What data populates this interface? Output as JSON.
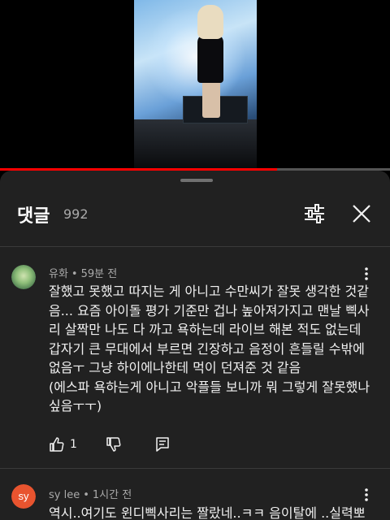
{
  "video": {
    "progress_fraction": 0.71,
    "progress_color": "#ff0000"
  },
  "comments_panel": {
    "title": "댓글",
    "count": "992",
    "icons": {
      "filter": "sliders-icon",
      "close": "close-icon"
    }
  },
  "comments": [
    {
      "author": "유화",
      "time": "59분 전",
      "text": "잘했고 못했고 따지는 게 아니고 수만씨가 잘못 생각한 것같음... 요즘 아이돌 평가 기준만 겁나 높아져가지고 맨날 삑사리 살짝만 나도 다 까고 욕하는데 라이브 해본 적도 없는데 갑자기 큰 무대에서 부르면 긴장하고 음정이 흔들릴 수밖에 없음ㅜ 그냥 하이에나한테 먹이 던져준 것 같음\n(에스파 욕하는게 아니고 악플들 보니까 뭐 그렇게 잘못했나 싶음ㅜㅜ)",
      "likes": "1",
      "icons": {
        "like": "thumbs-up-icon",
        "dislike": "thumbs-down-icon",
        "reply": "reply-icon",
        "more": "more-vertical-icon"
      }
    },
    {
      "author": "sy lee",
      "avatar_letters": "sy",
      "avatar_color": "#e8542f",
      "time": "1시간 전",
      "text": "역시..여기도 윈디삑사리는 짤랐네..ㅋㅋ 음이탈에 ..실력뽀",
      "icons": {
        "more": "more-vertical-icon"
      }
    }
  ]
}
